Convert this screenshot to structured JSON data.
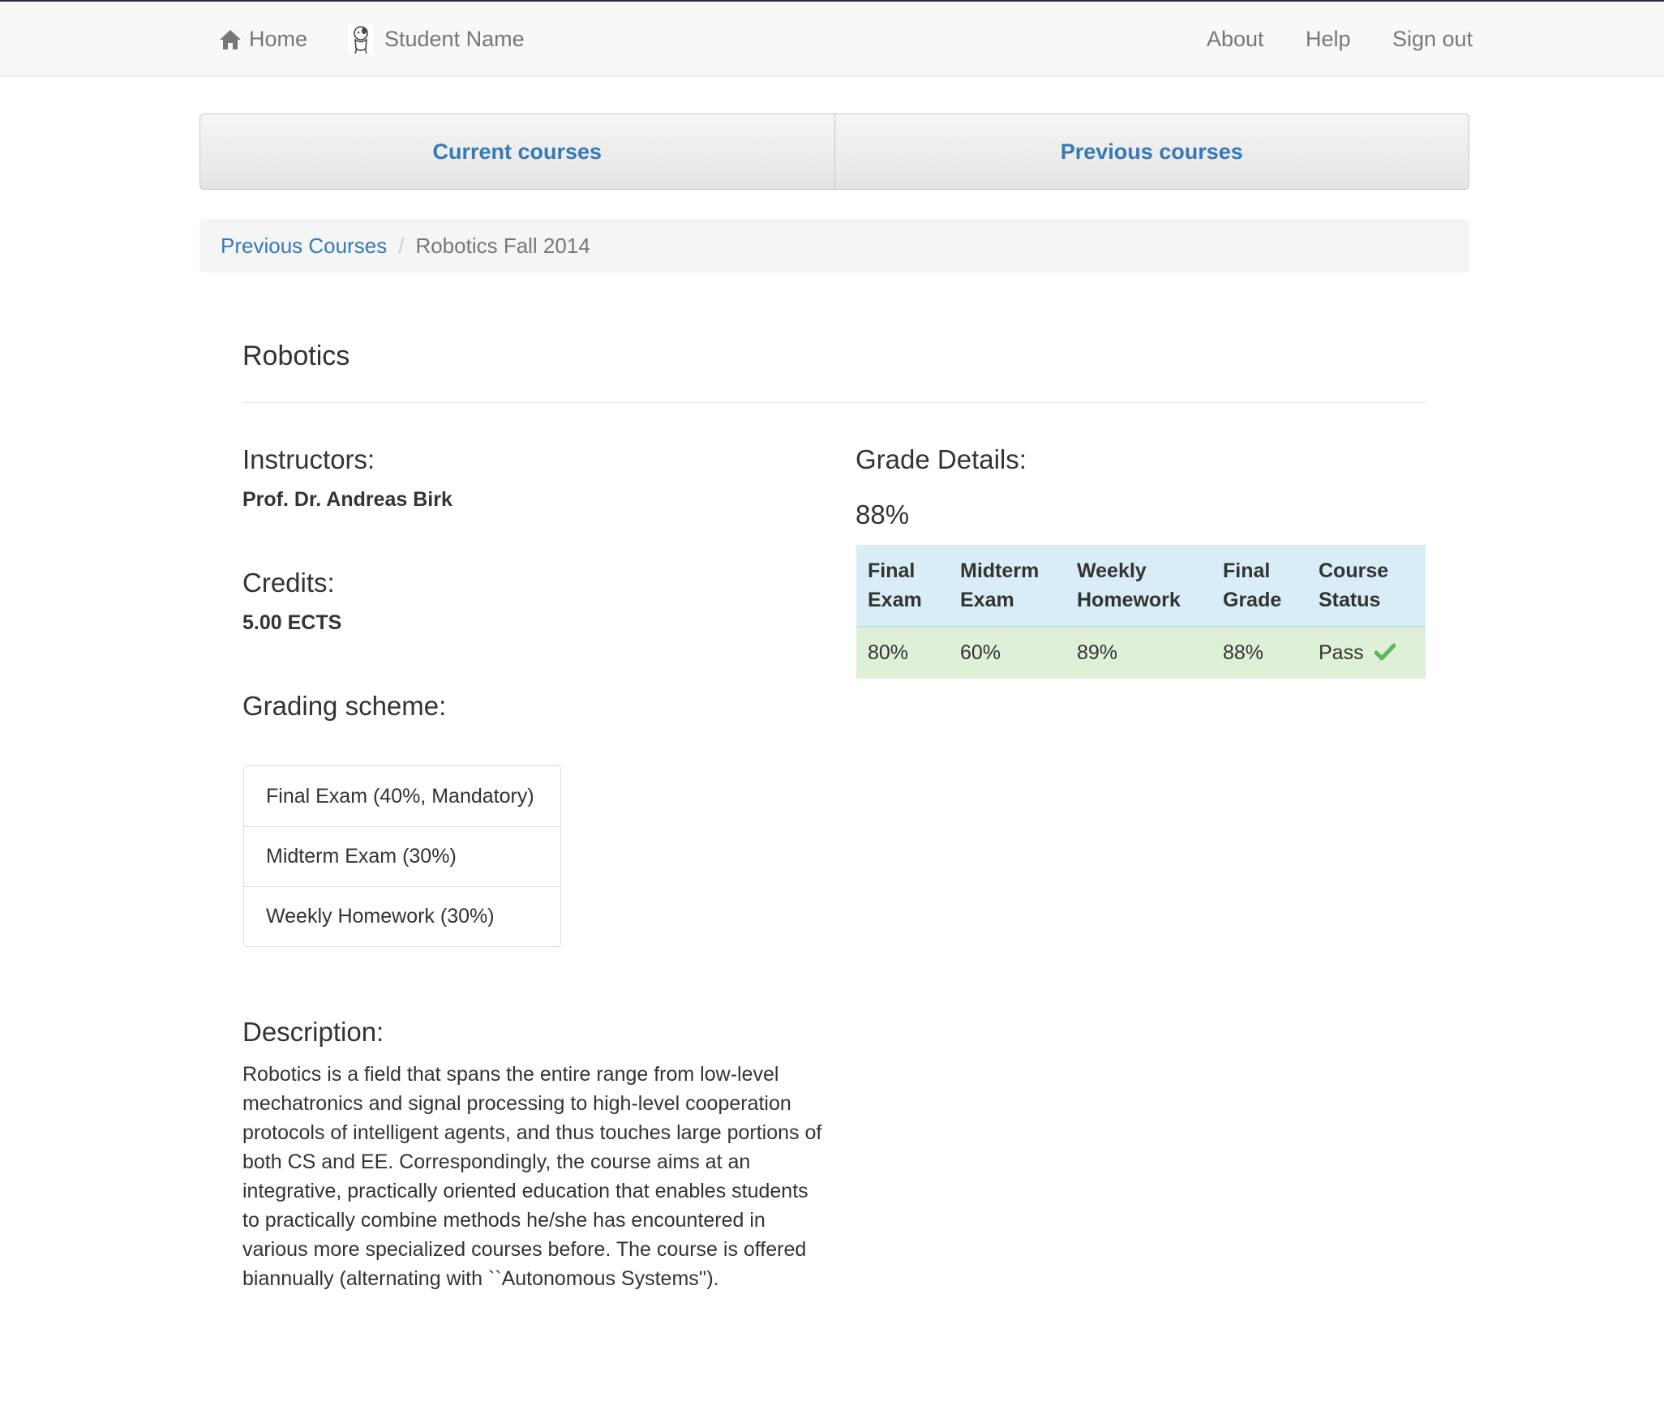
{
  "navbar": {
    "home_label": "Home",
    "student_name": "Student Name",
    "about_label": "About",
    "help_label": "Help",
    "signout_label": "Sign out"
  },
  "course_tabs": [
    {
      "label": "Current courses"
    },
    {
      "label": "Previous courses"
    }
  ],
  "breadcrumb": {
    "parent": "Previous Courses",
    "separator": "/",
    "current": "Robotics Fall 2014"
  },
  "course": {
    "title": "Robotics",
    "instructors_heading": "Instructors:",
    "instructors": "Prof. Dr. Andreas Birk",
    "credits_heading": "Credits:",
    "credits": "5.00 ECTS",
    "grading_heading": "Grading scheme:",
    "grading_scheme": [
      "Final Exam (40%, Mandatory)",
      "Midterm Exam (30%)",
      "Weekly Homework (30%)"
    ],
    "description_heading": "Description:",
    "description": "Robotics is a field that spans the entire range from low-level mechatronics and signal processing to high-level cooperation protocols of intelligent agents, and thus touches large portions of both CS and EE. Correspondingly, the course aims at an integrative, practically oriented education that enables students to practically combine methods he/she has encountered in various more specialized courses before. The course is offered biannually (alternating with ``Autonomous Systems'')."
  },
  "grades": {
    "heading": "Grade Details:",
    "overall": "88%",
    "columns": [
      {
        "line1": "Final",
        "line2": "Exam"
      },
      {
        "line1": "Midterm",
        "line2": "Exam"
      },
      {
        "line1": "Weekly",
        "line2": "Homework"
      },
      {
        "line1": "Final",
        "line2": "Grade"
      },
      {
        "line1": "Course",
        "line2": "Status"
      }
    ],
    "row": [
      "80%",
      "60%",
      "89%",
      "88%",
      "Pass"
    ],
    "status_icon": "checkmark-icon",
    "status_color": "#5cb85c"
  },
  "colors": {
    "link": "#337ab7",
    "table_header_bg": "#d9edf7",
    "table_row_bg": "#dff0d8"
  }
}
